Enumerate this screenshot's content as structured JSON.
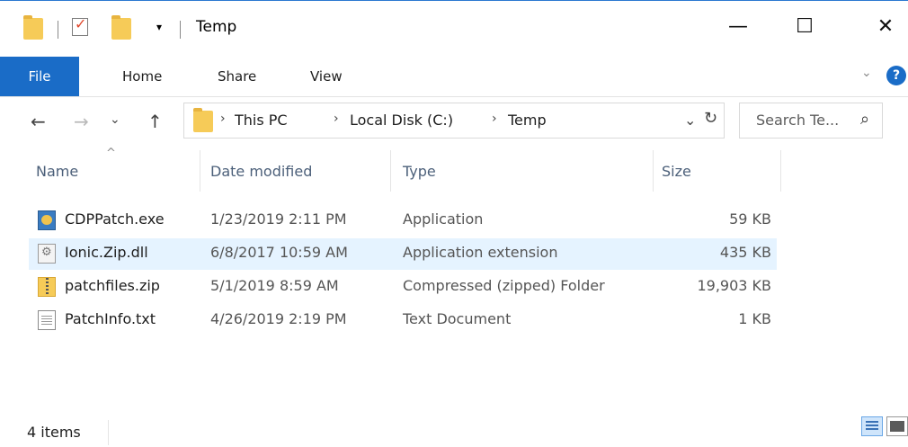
{
  "window": {
    "title": "Temp"
  },
  "window_buttons": {
    "minimize": "—",
    "maximize": "☐",
    "close": "✕"
  },
  "quick_access": {
    "customize_glyph": "▾"
  },
  "ribbon": {
    "tabs": [
      {
        "label": "File"
      },
      {
        "label": "Home"
      },
      {
        "label": "Share"
      },
      {
        "label": "View"
      }
    ],
    "expand_glyph": "⌄",
    "help_glyph": "?"
  },
  "nav": {
    "back": "←",
    "forward": "→",
    "recent": "⌄",
    "up": "↑"
  },
  "address": {
    "crumbs": [
      "This PC",
      "Local Disk (C:)",
      "Temp"
    ],
    "separator": "›",
    "dropdown_glyph": "⌄",
    "refresh_glyph": "↻"
  },
  "search": {
    "placeholder": "Search Te...",
    "icon_glyph": "⌕"
  },
  "columns": {
    "name": "Name",
    "date": "Date modified",
    "type": "Type",
    "size": "Size",
    "sort_glyph": "^"
  },
  "files": [
    {
      "name": "CDPPatch.exe",
      "date": "1/23/2019 2:11 PM",
      "type": "Application",
      "size": "59 KB",
      "icon": "exe-icon"
    },
    {
      "name": "Ionic.Zip.dll",
      "date": "6/8/2017 10:59 AM",
      "type": "Application extension",
      "size": "435 KB",
      "icon": "dll-icon"
    },
    {
      "name": "patchfiles.zip",
      "date": "5/1/2019 8:59 AM",
      "type": "Compressed (zipped) Folder",
      "size": "19,903 KB",
      "icon": "zip-icon"
    },
    {
      "name": "PatchInfo.txt",
      "date": "4/26/2019 2:19 PM",
      "type": "Text Document",
      "size": "1 KB",
      "icon": "txt-icon"
    }
  ],
  "status": {
    "count": "4 items"
  },
  "colors": {
    "accent": "#1a6cc7",
    "hover_row": "#e5f3ff",
    "header_text": "#4c607a",
    "folder": "#f6cb58"
  }
}
